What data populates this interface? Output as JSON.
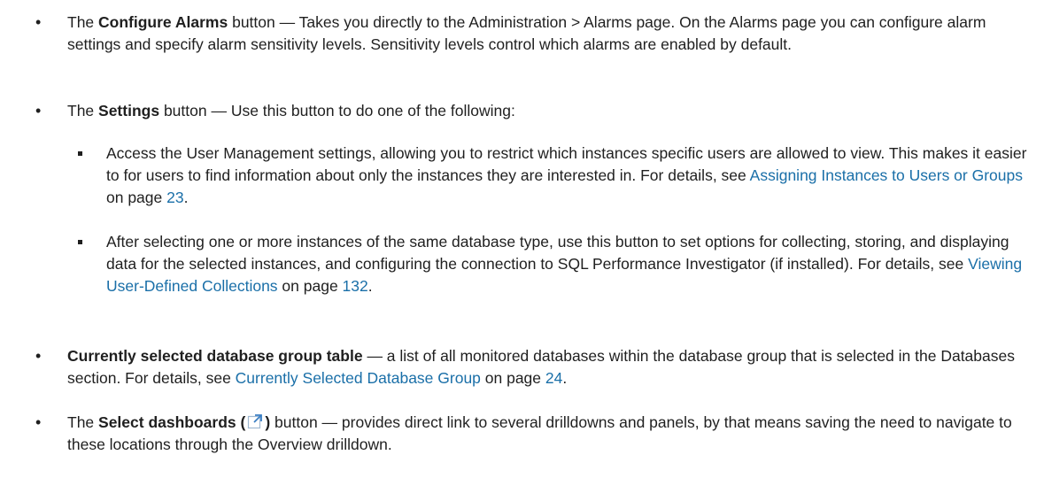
{
  "items": {
    "alarms": {
      "pre": "The ",
      "bold": "Configure Alarms",
      "text": " button — Takes you directly to the Administration > Alarms page. On the Alarms page you can configure alarm settings and specify alarm sensitivity levels. Sensitivity levels control which alarms are enabled by default."
    },
    "settings": {
      "pre": "The ",
      "bold": "Settings",
      "text": " button — Use this button to do one of the following:",
      "sub1": {
        "text": "Access the User Management settings, allowing you to restrict which instances specific users are allowed to view. This makes it easier to for users to find information about only the instances they are interested in. For details, see ",
        "link": "Assigning Instances to Users or Groups",
        "mid": " on page ",
        "page": "23",
        "end": "."
      },
      "sub2": {
        "text": "After selecting one or more instances of the same database type, use this button to set options for collecting, storing, and displaying data for the selected instances, and configuring the connection to SQL Performance Investigator (if installed). For details, see ",
        "link": "Viewing User-Defined Collections",
        "mid": " on page ",
        "page": "132",
        "end": "."
      }
    },
    "group_table": {
      "bold": "Currently selected database group table",
      "text": " — a list of all monitored databases within the database group that is selected in the Databases section. For details, see ",
      "link": "Currently Selected Database Group",
      "mid": " on page ",
      "page": "24",
      "end": "."
    },
    "dashboards": {
      "pre": "The ",
      "bold_a": "Select dashboards (",
      "icon": "external-link-icon",
      "bold_b": ")",
      "text": " button — provides direct link to several drilldowns and panels, by that means saving the need to navigate to these locations through the Overview drilldown."
    }
  },
  "colors": {
    "text": "#1f1f1f",
    "link": "#1a6fa8",
    "icon_accent": "#3b7fc4"
  }
}
